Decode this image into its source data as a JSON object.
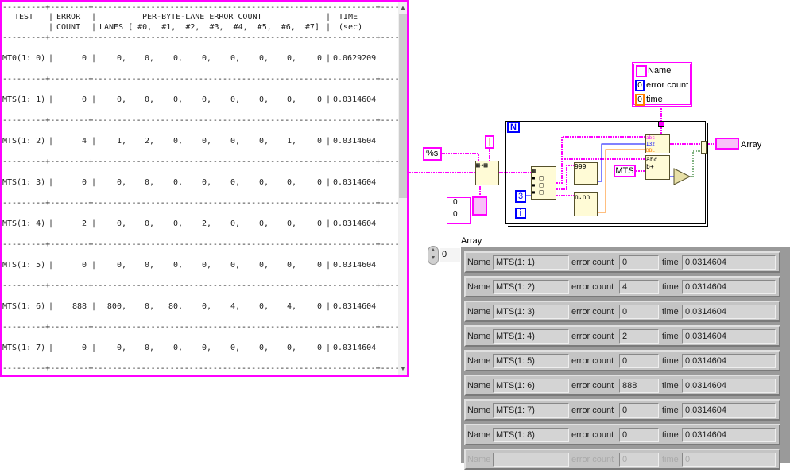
{
  "report": {
    "dash_line": "---------+--------+-----------------------------------------------------------+---------",
    "header": {
      "test": "TEST",
      "error": "ERROR",
      "count": "COUNT",
      "per_lane": "PER-BYTE-LANE ERROR COUNT",
      "lanes": "LANES [ #0,  #1,  #2,  #3,  #4,  #5,  #6,  #7]",
      "time": "TIME",
      "sec": "(sec)"
    },
    "rows": [
      {
        "test": "MT0(1: 0)",
        "count": "0",
        "lanes": [
          "0",
          "0",
          "0",
          "0",
          "0",
          "0",
          "0",
          "0"
        ],
        "time": "0.0629209"
      },
      {
        "test": "MTS(1: 1)",
        "count": "0",
        "lanes": [
          "0",
          "0",
          "0",
          "0",
          "0",
          "0",
          "0",
          "0"
        ],
        "time": "0.0314604"
      },
      {
        "test": "MTS(1: 2)",
        "count": "4",
        "lanes": [
          "1",
          "2",
          "0",
          "0",
          "0",
          "0",
          "1",
          "0"
        ],
        "time": "0.0314604"
      },
      {
        "test": "MTS(1: 3)",
        "count": "0",
        "lanes": [
          "0",
          "0",
          "0",
          "0",
          "0",
          "0",
          "0",
          "0"
        ],
        "time": "0.0314604"
      },
      {
        "test": "MTS(1: 4)",
        "count": "2",
        "lanes": [
          "0",
          "0",
          "0",
          "2",
          "0",
          "0",
          "0",
          "0"
        ],
        "time": "0.0314604"
      },
      {
        "test": "MTS(1: 5)",
        "count": "0",
        "lanes": [
          "0",
          "0",
          "0",
          "0",
          "0",
          "0",
          "0",
          "0"
        ],
        "time": "0.0314604"
      },
      {
        "test": "MTS(1: 6)",
        "count": "888",
        "lanes": [
          "800",
          "0",
          "80",
          "0",
          "4",
          "0",
          "4",
          "0"
        ],
        "time": "0.0314604"
      },
      {
        "test": "MTS(1: 7)",
        "count": "0",
        "lanes": [
          "0",
          "0",
          "0",
          "0",
          "0",
          "0",
          "0",
          "0"
        ],
        "time": "0.0314604"
      }
    ]
  },
  "diagram": {
    "cluster": {
      "name_label": "Name",
      "error_label": "error count",
      "error_value": "0",
      "time_label": "time",
      "time_value": "0"
    },
    "loop_n": "N",
    "loop_i": "i",
    "index_const": "3",
    "format_const": "%s",
    "delimiter_const": "|",
    "mts_const": "MTS",
    "array_const_values": [
      "0",
      "0"
    ],
    "array_indicator_label": "Array",
    "bundle_types": [
      "abc",
      "I32",
      "DBL"
    ],
    "compare_label": ">0",
    "num_fmt_int": "999",
    "num_fmt_dbl": "n.nn"
  },
  "array_panel": {
    "label": "Array",
    "index": "0",
    "labels": {
      "name": "Name",
      "error": "error count",
      "time": "time"
    },
    "rows": [
      {
        "name": "MTS(1: 1)",
        "error": "0",
        "time": "0.0314604"
      },
      {
        "name": "MTS(1: 2)",
        "error": "4",
        "time": "0.0314604"
      },
      {
        "name": "MTS(1: 3)",
        "error": "0",
        "time": "0.0314604"
      },
      {
        "name": "MTS(1: 4)",
        "error": "2",
        "time": "0.0314604"
      },
      {
        "name": "MTS(1: 5)",
        "error": "0",
        "time": "0.0314604"
      },
      {
        "name": "MTS(1: 6)",
        "error": "888",
        "time": "0.0314604"
      },
      {
        "name": "MTS(1: 7)",
        "error": "0",
        "time": "0.0314604"
      },
      {
        "name": "MTS(1: 8)",
        "error": "0",
        "time": "0.0314604"
      },
      {
        "name": "",
        "error": "0",
        "time": "0",
        "disabled": true
      }
    ]
  },
  "colors": {
    "string_wire": "#ff00ff",
    "int_wire": "#0000ff",
    "dbl_wire": "#ff7f00",
    "bool_wire": "#006600",
    "report_border": "#ff00ff"
  }
}
